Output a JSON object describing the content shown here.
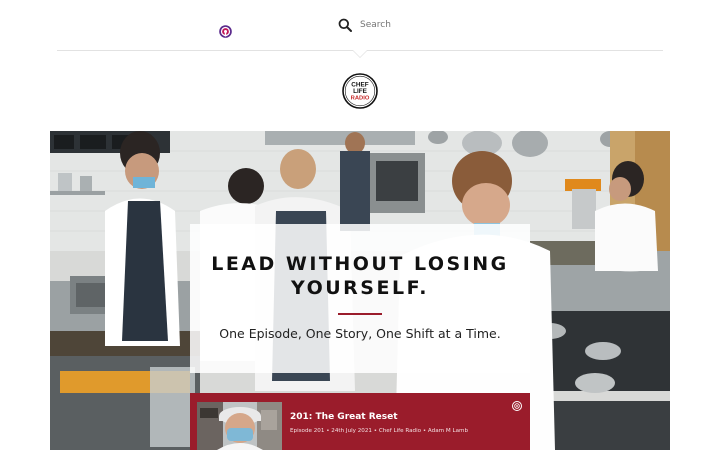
{
  "header": {
    "search_placeholder": "Search",
    "icons": [
      "podcast-icon",
      "search-icon"
    ]
  },
  "logo": {
    "line1": "CHEF",
    "line2": "LIFE",
    "line3": "RADIO"
  },
  "hero": {
    "headline_line1": "LEAD WITHOUT LOSING",
    "headline_line2": "YOURSELF.",
    "tagline": "One Episode, One Story, One Shift at a Time.",
    "image": "commercial kitchen with chefs cooking"
  },
  "episode": {
    "title": "201: The Great Reset",
    "meta": "Episode 201 • 24th July 2021 • Chef Life Radio • Adam M Lamb",
    "icon": "podcast-icon",
    "thumbnail": "chef wearing face mask and cap"
  },
  "colors": {
    "brand_red": "#9a1c2b",
    "divider": "#e2e2e2"
  }
}
